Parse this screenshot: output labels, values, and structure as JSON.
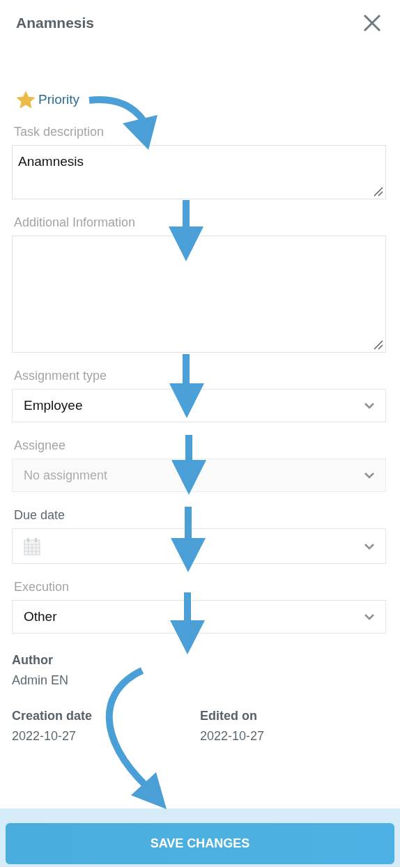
{
  "header": {
    "title": "Anamnesis"
  },
  "priority": {
    "label": "Priority",
    "starred": true
  },
  "fields": [
    {
      "kind": "textarea",
      "label": "Task description",
      "value": "Anamnesis",
      "label_active": false
    },
    {
      "kind": "textarea",
      "label": "Additional Information",
      "label_active": false
    },
    {
      "kind": "select",
      "label": "Assignment type",
      "value": "Employee",
      "label_active": false,
      "disabled": false
    },
    {
      "kind": "select",
      "label": "Assignee",
      "placeholder": "No assignment",
      "label_active": false,
      "disabled": true
    },
    {
      "kind": "date",
      "label": "Due date",
      "label_active": true,
      "disabled": false
    },
    {
      "kind": "select",
      "label": "Execution",
      "value": "Other",
      "label_active": false,
      "disabled": false
    }
  ],
  "author": {
    "label": "Author",
    "value": "Admin EN"
  },
  "dates": [
    {
      "label": "Creation date",
      "value": "2022-10-27"
    },
    {
      "label": "Edited on",
      "value": "2022-10-27"
    }
  ],
  "footer": {
    "button": "SAVE CHANGES"
  }
}
